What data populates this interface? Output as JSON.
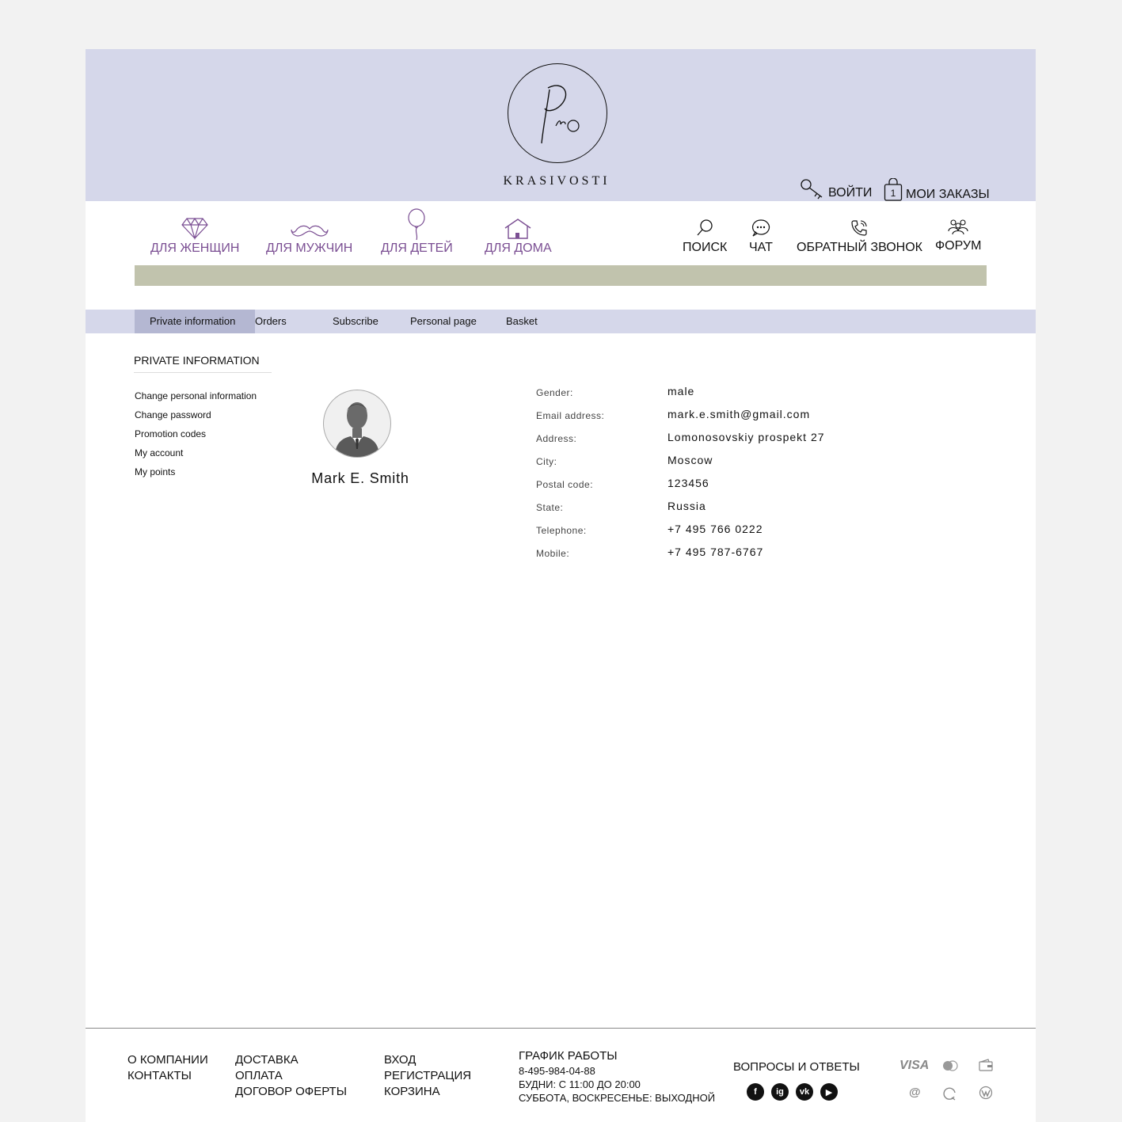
{
  "header": {
    "logo_script": "Pro",
    "logo_text": "KRASIVOSTI",
    "login_label": "ВОЙТИ",
    "orders_label": "МОИ ЗАКАЗЫ",
    "orders_count": "1"
  },
  "categories": [
    {
      "label": "ДЛЯ ЖЕНЩИН",
      "icon": "diamond-icon"
    },
    {
      "label": "ДЛЯ МУЖЧИН",
      "icon": "mustache-icon"
    },
    {
      "label": "ДЛЯ ДЕТЕЙ",
      "icon": "balloon-icon"
    },
    {
      "label": "ДЛЯ ДОМА",
      "icon": "house-icon"
    }
  ],
  "utilities": [
    {
      "label": "ПОИСК",
      "icon": "search-icon"
    },
    {
      "label": "ЧАТ",
      "icon": "chat-icon"
    },
    {
      "label": "ОБРАТНЫЙ ЗВОНОК",
      "icon": "phone-icon"
    },
    {
      "label": "ФОРУМ",
      "icon": "users-icon"
    }
  ],
  "tabs": [
    "Private information",
    "Orders",
    "Subscribe",
    "Personal page",
    "Basket"
  ],
  "sidebar": {
    "title": "PRIVATE INFORMATION",
    "links": [
      "Change personal information",
      "Change password",
      "Promotion codes",
      "My account",
      "My points"
    ]
  },
  "profile": {
    "name": "Mark E. Smith",
    "fields": [
      {
        "label": "Gender:",
        "value": "male"
      },
      {
        "label": "Email address:",
        "value": "mark.e.smith@gmail.com"
      },
      {
        "label": "Address:",
        "value": "Lomonosovskiy prospekt 27"
      },
      {
        "label": "City:",
        "value": "Moscow"
      },
      {
        "label": "Postal code:",
        "value": "123456"
      },
      {
        "label": "State:",
        "value": "Russia"
      },
      {
        "label": "Telephone:",
        "value": "+7 495 766 0222"
      },
      {
        "label": "Mobile:",
        "value": "+7 495 787-6767"
      }
    ]
  },
  "footer": {
    "col1": [
      "О КОМПАНИИ",
      "КОНТАКТЫ"
    ],
    "col2": [
      "ДОСТАВКА",
      "ОПЛАТА",
      "ДОГОВОР ОФЕРТЫ"
    ],
    "col3": [
      "ВХОД",
      "РЕГИСТРАЦИЯ",
      "КОРЗИНА"
    ],
    "schedule_title": "ГРАФИК РАБОТЫ",
    "phone": "8-495-984-04-88",
    "weekdays": "БУДНИ: С 11:00 ДО 20:00",
    "weekend": "СУББОТА, ВОСКРЕСЕНЬЕ: ВЫХОДНОЙ",
    "faq": "ВОПРОСЫ И ОТВЕТЫ",
    "social": [
      "f",
      "ig",
      "vk",
      "▶"
    ],
    "pay_visa": "VISA",
    "pay_at": "@"
  },
  "colors": {
    "header_bg": "#d5d7ea",
    "accent": "#7b4f93",
    "banner": "#c1c3ad",
    "tab_active": "#b4b7d2"
  }
}
